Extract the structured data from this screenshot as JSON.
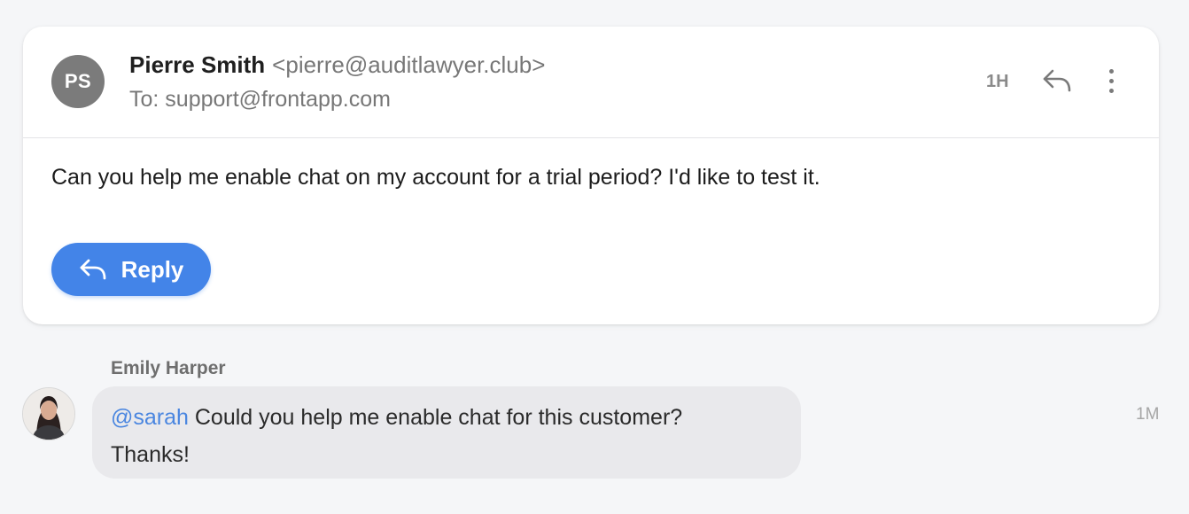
{
  "message": {
    "avatar_initials": "PS",
    "sender_name": "Pierre Smith",
    "sender_email": "<pierre@auditlawyer.club>",
    "to_line": "To: support@frontapp.com",
    "time": "1H",
    "body": "Can you help me enable chat on my account for a trial period? I'd like to test it.",
    "reply_label": "Reply",
    "colors": {
      "avatar_bg": "#7b7b7b",
      "reply_button": "#4384e8"
    },
    "icons": [
      "reply-icon",
      "more-vertical-icon"
    ]
  },
  "comment": {
    "author": "Emily Harper",
    "mention": "@sarah",
    "text_line1": " Could you help me enable chat for this customer?",
    "text_line2": "Thanks!",
    "time": "1M",
    "colors": {
      "bubble_bg": "#e9e9ec",
      "mention": "#4a86e0"
    }
  }
}
